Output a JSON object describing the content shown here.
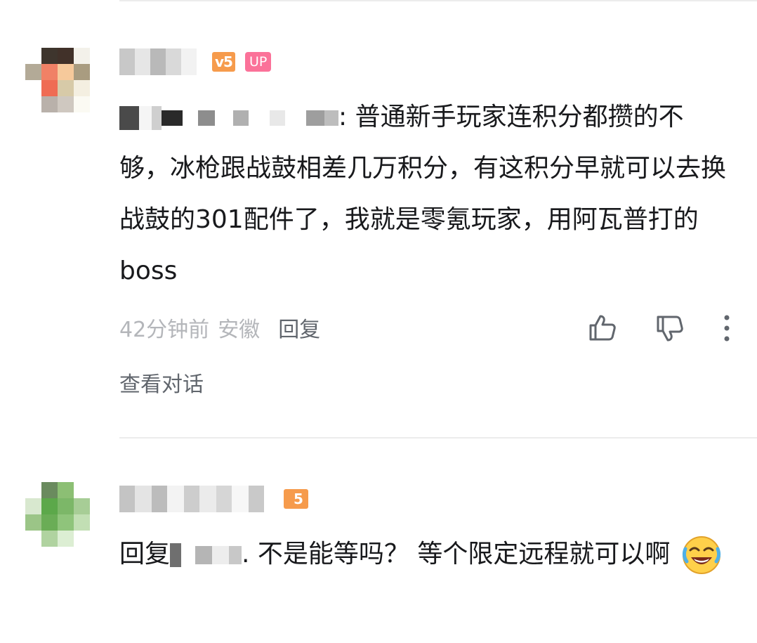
{
  "comment1": {
    "user_level_badge": "v5",
    "up_badge": "UP",
    "content_prefix": ":",
    "content_text": " 普通新手玩家连积分都攒的不够，冰枪跟战鼓相差几万积分，有这积分早就可以去换战鼓的301配件了，我就是零氪玩家，用阿瓦普打的boss",
    "time": "42分钟前",
    "location": "安徽",
    "reply_label": "回复",
    "view_conversation": "查看对话",
    "icons": [
      "thumbs-up-icon",
      "thumbs-down-icon",
      "more-vertical-icon"
    ]
  },
  "comment2": {
    "user_level_badge": "5",
    "reply_prefix": "回复",
    "content_text": ". 不是能等吗？ 等个限定远程就可以啊",
    "emoji": "laughing-crying-emoji"
  },
  "colors": {
    "level_badge": "#f69b4c",
    "up_badge": "#fb7299",
    "text_primary": "#18191c",
    "text_secondary": "#61666d",
    "text_muted": "#b4b6ba",
    "divider": "#ececec"
  }
}
